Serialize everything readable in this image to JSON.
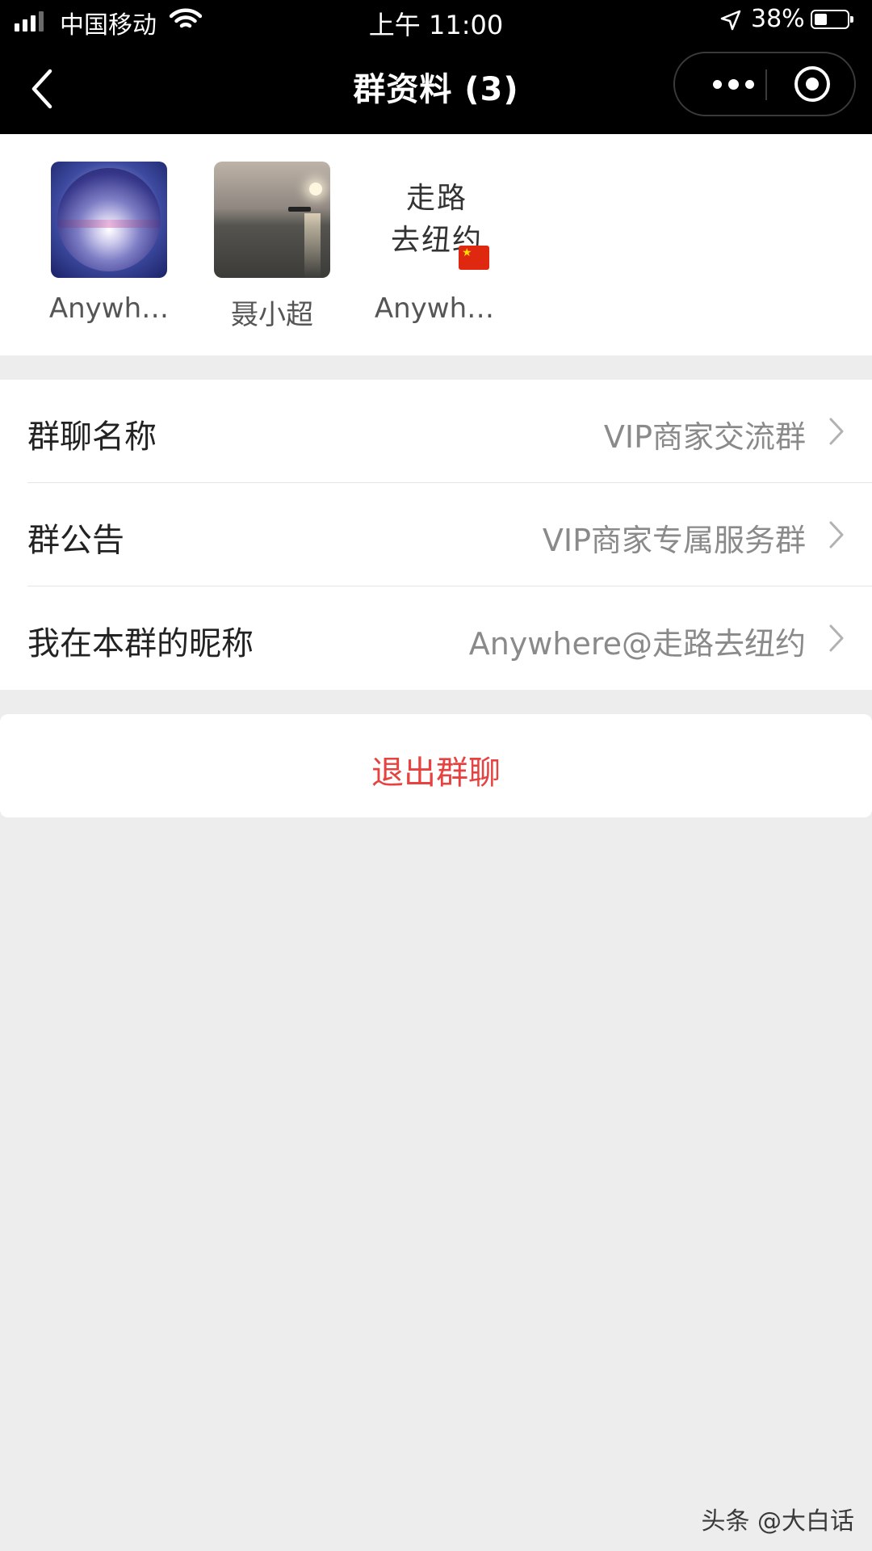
{
  "status_bar": {
    "carrier": "中国移动",
    "time": "上午 11:00",
    "battery": "38%"
  },
  "nav": {
    "title": "群资料 (3)"
  },
  "members": [
    {
      "name": "Anywh…"
    },
    {
      "name": "聂小超"
    },
    {
      "name": "Anywh…",
      "avatar_text": "走路\n去纽约"
    }
  ],
  "settings": [
    {
      "label": "群聊名称",
      "value": "VIP商家交流群"
    },
    {
      "label": "群公告",
      "value": "VIP商家专属服务群"
    },
    {
      "label": "我在本群的昵称",
      "value": "Anywhere@走路去纽约"
    }
  ],
  "actions": {
    "exit_label": "退出群聊"
  },
  "watermark": "头条 @大白话",
  "colors": {
    "topbar": "#000000",
    "background": "#ededed",
    "exit_text": "#e64340",
    "value_text": "#8a8a8a"
  }
}
